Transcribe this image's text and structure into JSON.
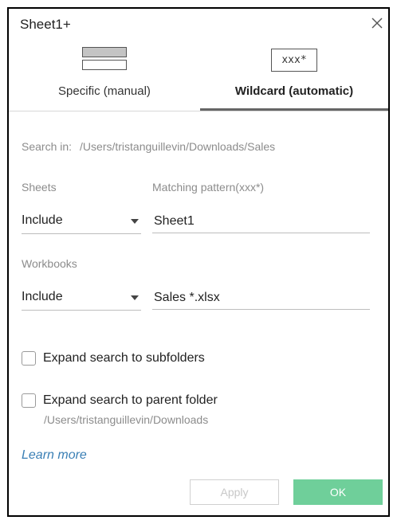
{
  "dialog": {
    "title": "Sheet1+"
  },
  "tabs": {
    "specific": {
      "label": "Specific (manual)",
      "icon": "list-rows-icon"
    },
    "wildcard": {
      "label": "Wildcard (automatic)",
      "icon_text": "xxx*",
      "selected": true
    }
  },
  "search": {
    "label": "Search in:",
    "path": "/Users/tristanguillevin/Downloads/Sales"
  },
  "sheets": {
    "label": "Sheets",
    "pattern_label": "Matching pattern(xxx*)",
    "mode": "Include",
    "pattern_value": "Sheet1"
  },
  "workbooks": {
    "label": "Workbooks",
    "mode": "Include",
    "pattern_value": "Sales *.xlsx"
  },
  "options": {
    "subfolders_label": "Expand search to subfolders",
    "subfolders_checked": false,
    "parent_label": "Expand search to parent folder",
    "parent_checked": false,
    "parent_path": "/Users/tristanguillevin/Downloads"
  },
  "learn_more": "Learn more",
  "buttons": {
    "apply": "Apply",
    "ok": "OK"
  },
  "colors": {
    "ok_button": "#6fcf9a",
    "link": "#3a7fb5",
    "tab_underline": "#666666"
  }
}
